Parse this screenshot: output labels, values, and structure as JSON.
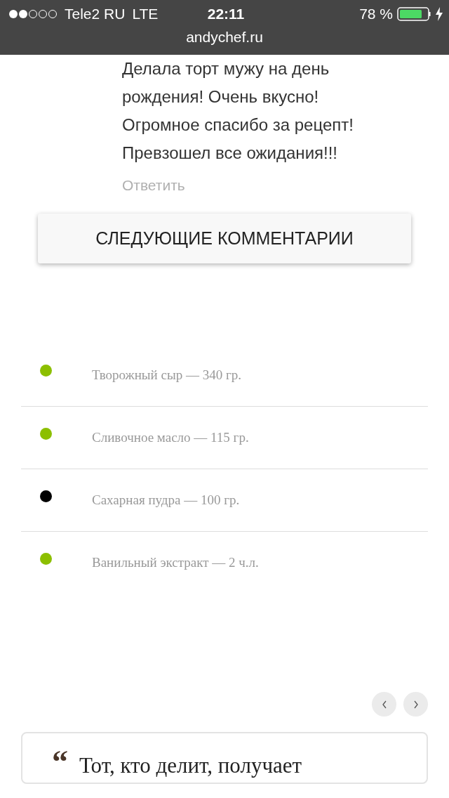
{
  "status_bar": {
    "carrier": "Tele2 RU",
    "network": "LTE",
    "time": "22:11",
    "battery": "78 %"
  },
  "address_bar": {
    "url": "andychef.ru"
  },
  "comment": {
    "lines": [
      "Делала торт мужу на день",
      "рождения! Очень вкусно!",
      "Огромное спасибо за рецепт!",
      "Превзошел все ожидания!!!"
    ],
    "reply": "Ответить"
  },
  "more_button": "СЛЕДУЮЩИЕ КОММЕНТАРИИ",
  "ingredients": [
    {
      "text": "Творожный сыр — 340 гр.",
      "color": "#8cbf00"
    },
    {
      "text": "Сливочное масло — 115 гр.",
      "color": "#8cbf00"
    },
    {
      "text": "Сахарная пудра — 100 гр.",
      "color": "#000000"
    },
    {
      "text": "Ванильный экстракт — 2 ч.л.",
      "color": "#8cbf00"
    }
  ],
  "quote": {
    "mark": "“",
    "text": "Тот, кто делит, получает"
  }
}
